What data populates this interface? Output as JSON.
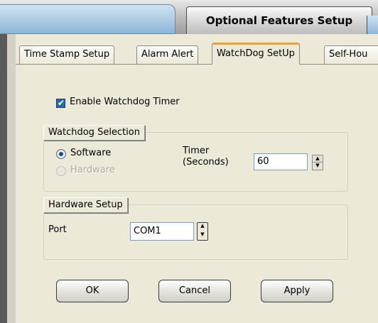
{
  "window": {
    "title": "Optional Features Setup"
  },
  "tabs": [
    {
      "label": "Time Stamp Setup",
      "active": false
    },
    {
      "label": "Alarm Alert",
      "active": false
    },
    {
      "label": "WatchDog SetUp",
      "active": true
    },
    {
      "label": "Self-Hou",
      "active": false
    }
  ],
  "watchdog": {
    "enable_label": "Enable Watchdog Timer",
    "enabled": true
  },
  "selection": {
    "group_label": "Watchdog Selection",
    "software_label": "Software",
    "software_selected": true,
    "hardware_label": "Hardware",
    "hardware_enabled": false,
    "timer_label_line1": "Timer",
    "timer_label_line2": "(Seconds)",
    "timer_value": "60"
  },
  "hardware_setup": {
    "group_label": "Hardware Setup",
    "port_label": "Port",
    "port_value": "COM1"
  },
  "buttons": {
    "ok": "OK",
    "cancel": "Cancel",
    "apply": "Apply"
  }
}
